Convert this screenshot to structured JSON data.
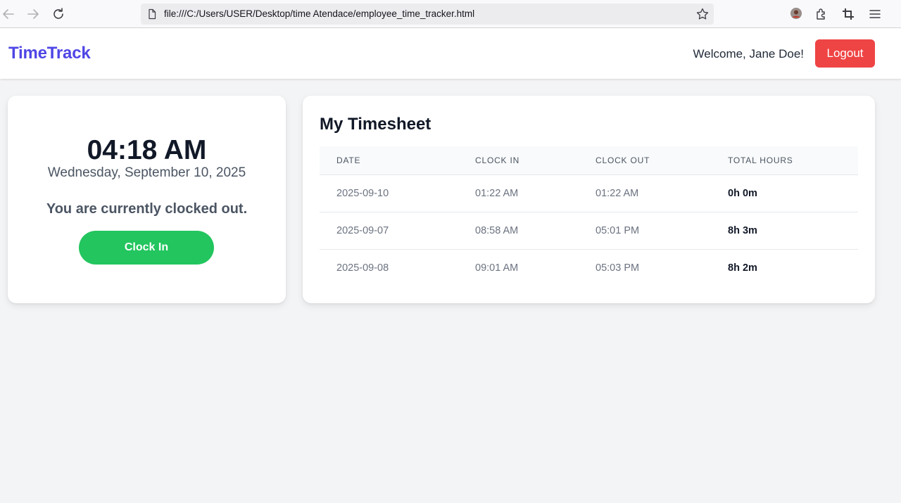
{
  "browser": {
    "url": "file:///C:/Users/USER/Desktop/time Atendace/employee_time_tracker.html"
  },
  "header": {
    "brand": "TimeTrack",
    "welcome": "Welcome, Jane Doe!",
    "logout_label": "Logout"
  },
  "clock": {
    "time": "04:18 AM",
    "date": "Wednesday, September 10, 2025",
    "status": "You are currently clocked out.",
    "button_label": "Clock In"
  },
  "timesheet": {
    "title": "My Timesheet",
    "columns": [
      "DATE",
      "CLOCK IN",
      "CLOCK OUT",
      "TOTAL HOURS"
    ],
    "rows": [
      {
        "date": "2025-09-10",
        "clock_in": "01:22 AM",
        "clock_out": "01:22 AM",
        "total": "0h 0m"
      },
      {
        "date": "2025-09-07",
        "clock_in": "08:58 AM",
        "clock_out": "05:01 PM",
        "total": "8h 3m"
      },
      {
        "date": "2025-09-08",
        "clock_in": "09:01 AM",
        "clock_out": "05:03 PM",
        "total": "8h 2m"
      }
    ]
  },
  "colors": {
    "brand": "#4f46e5",
    "logout": "#ef4444",
    "clock_in": "#22c55e",
    "background": "#f3f4f6"
  }
}
